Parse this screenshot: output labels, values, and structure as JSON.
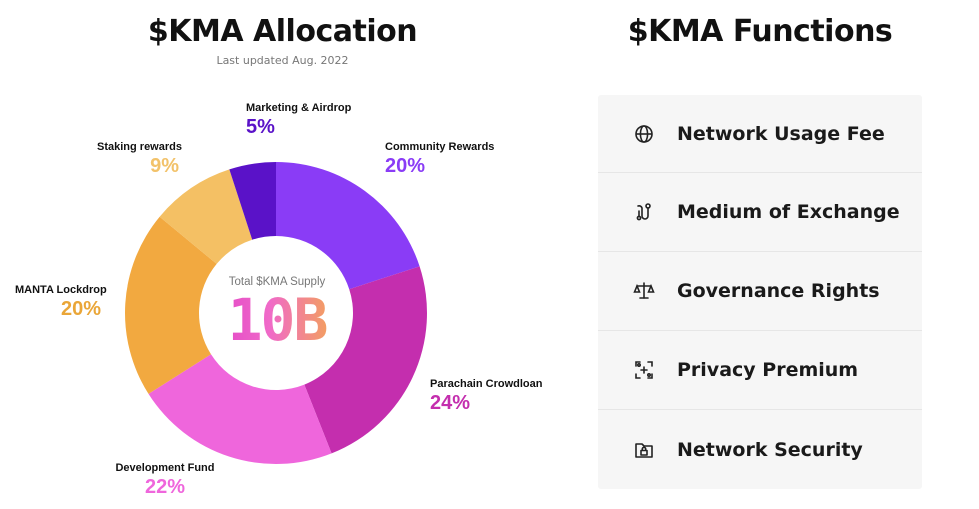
{
  "header": {
    "allocation_title": "$KMA Allocation",
    "last_updated": "Last updated Aug. 2022",
    "functions_title": "$KMA Functions"
  },
  "chart_data": {
    "type": "pie",
    "title": "$KMA Allocation",
    "subtitle": "Last updated Aug. 2022",
    "center_caption": "Total $KMA Supply",
    "center_value": "10B",
    "slices": [
      {
        "name": "Community Rewards",
        "value": 20,
        "label": "20%",
        "color": "#8a3cf6"
      },
      {
        "name": "Parachain Crowdloan",
        "value": 24,
        "label": "24%",
        "color": "#c42eae"
      },
      {
        "name": "Development Fund",
        "value": 22,
        "label": "22%",
        "color": "#ef66dc"
      },
      {
        "name": "MANTA Lockdrop",
        "value": 20,
        "label": "20%",
        "color": "#f2a940"
      },
      {
        "name": "Staking rewards",
        "value": 9,
        "label": "9%",
        "color": "#f4c064"
      },
      {
        "name": "Marketing & Airdrop",
        "value": 5,
        "label": "5%",
        "color": "#5a12c8"
      }
    ],
    "label_colors": {
      "Community Rewards": "#8a3cf6",
      "Parachain Crowdloan": "#c42eae",
      "Development Fund": "#ef66dc",
      "MANTA Lockdrop": "#eaa638",
      "Staking rewards": "#f2c26a",
      "Marketing & Airdrop": "#5a12c8"
    }
  },
  "functions": [
    {
      "label": "Network Usage Fee",
      "icon": "globe-icon"
    },
    {
      "label": "Medium of Exchange",
      "icon": "exchange-path-icon"
    },
    {
      "label": "Governance Rights",
      "icon": "scales-icon"
    },
    {
      "label": "Privacy Premium",
      "icon": "privacy-frame-icon"
    },
    {
      "label": "Network Security",
      "icon": "locked-folder-icon"
    }
  ]
}
